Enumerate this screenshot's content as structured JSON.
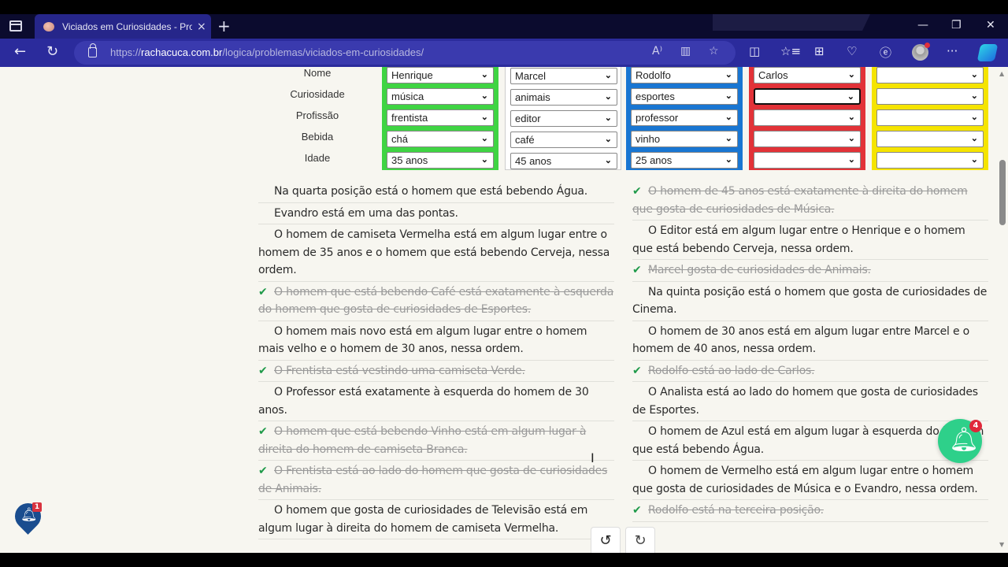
{
  "browser": {
    "tab_title": "Viciados em Curiosidades - Probl",
    "tab_close": "×",
    "new_tab": "+",
    "url_prefix": "https://",
    "url_domain": "rachacuca.com.br",
    "url_path": "/logica/problemas/viciados-em-curiosidades/",
    "window_controls": {
      "minimize": "—",
      "restore": "❐",
      "close": "✕"
    },
    "nav": {
      "back": "←",
      "refresh": "↻"
    },
    "address_icons": {
      "read_aloud": "A⁾",
      "immersive_reader": "▥",
      "favorite": "☆"
    },
    "toolbar_icons": {
      "split_screen": "◫",
      "favorites": "☆≡",
      "collections": "⊞",
      "performance": "♡",
      "ie_mode": "ⓔ",
      "more": "···"
    }
  },
  "grid": {
    "row_labels": [
      "Nome",
      "Curiosidade",
      "Profissão",
      "Bebida",
      "Idade"
    ],
    "columns": [
      {
        "color": "green",
        "color_hex": "#3fd443",
        "values": [
          "Henrique",
          "música",
          "frentista",
          "chá",
          "35 anos"
        ]
      },
      {
        "color": "white",
        "color_hex": "#ffffff",
        "values": [
          "Marcel",
          "animais",
          "editor",
          "café",
          "45 anos"
        ]
      },
      {
        "color": "blue",
        "color_hex": "#1976d2",
        "values": [
          "Rodolfo",
          "esportes",
          "professor",
          "vinho",
          "25 anos"
        ]
      },
      {
        "color": "red",
        "color_hex": "#e23238",
        "values": [
          "Carlos",
          "",
          "",
          "",
          ""
        ]
      },
      {
        "color": "yellow",
        "color_hex": "#f5e400",
        "values": [
          "",
          "",
          "",
          "",
          ""
        ]
      }
    ],
    "chevron": "⌄"
  },
  "clues_left": [
    {
      "text": "Na quarta posição está o homem que está bebendo Água.",
      "done": false
    },
    {
      "text": "Evandro está em uma das pontas.",
      "done": false
    },
    {
      "text": "O homem de camiseta Vermelha está em algum lugar entre o homem de 35 anos e o homem que está bebendo Cerveja, nessa ordem.",
      "done": false
    },
    {
      "text": "O homem que está bebendo Café está exatamente à esquerda do homem que gosta de curiosidades de Esportes.",
      "done": true
    },
    {
      "text": "O homem mais novo está em algum lugar entre o homem mais velho e o homem de 30 anos, nessa ordem.",
      "done": false
    },
    {
      "text": "O Frentista está vestindo uma camiseta Verde.",
      "done": true
    },
    {
      "text": "O Professor está exatamente à esquerda do homem de 30 anos.",
      "done": false
    },
    {
      "text": "O homem que está bebendo Vinho está em algum lugar à direita do homem de camiseta Branca.",
      "done": true
    },
    {
      "text": "O Frentista está ao lado do homem que gosta de curiosidades de Animais.",
      "done": true
    },
    {
      "text": "O homem que gosta de curiosidades de Televisão está em algum lugar à direita do homem de camiseta Vermelha.",
      "done": false
    }
  ],
  "clues_right": [
    {
      "text": "O homem de 45 anos está exatamente à direita do homem que gosta de curiosidades de Música.",
      "done": true
    },
    {
      "text": "O Editor está em algum lugar entre o Henrique e o homem que está bebendo Cerveja, nessa ordem.",
      "done": false
    },
    {
      "text": "Marcel gosta de curiosidades de Animais.",
      "done": true
    },
    {
      "text": "Na quinta posição está o homem que gosta de curiosidades de Cinema.",
      "done": false
    },
    {
      "text": "O homem de 30 anos está em algum lugar entre Marcel e o homem de 40 anos, nessa ordem.",
      "done": false
    },
    {
      "text": "Rodolfo está ao lado de Carlos.",
      "done": true
    },
    {
      "text": "O Analista está ao lado do homem que gosta de curiosidades de Esportes.",
      "done": false
    },
    {
      "text": "O homem de Azul está em algum lugar à esquerda do homem que está bebendo Água.",
      "done": false
    },
    {
      "text": "O homem de Vermelho está em algum lugar entre o homem que gosta de curiosidades de Música e o Evandro, nessa ordem.",
      "done": false
    },
    {
      "text": "Rodolfo está na terceira posição.",
      "done": true
    }
  ],
  "check_icon": "✔",
  "controls": {
    "undo": "↺",
    "redo": "↻"
  },
  "notifications": {
    "left_badge": "1",
    "right_badge": "4",
    "bell": "🔔︎"
  },
  "scrollbar": {
    "up": "▲",
    "down": "▼"
  }
}
